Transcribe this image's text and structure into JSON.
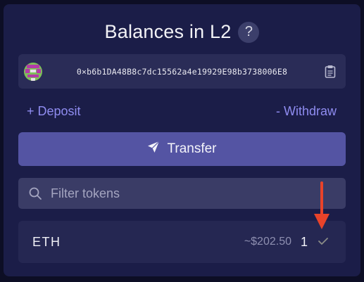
{
  "header": {
    "title": "Balances in L2",
    "help_glyph": "?"
  },
  "account": {
    "address": "0×b6b1DA48B8c7dc15562a4e19929E98b3738006E8",
    "avatar_icon": "identicon",
    "copy_icon": "clipboard-icon"
  },
  "actions": {
    "deposit_label": "+ Deposit",
    "withdraw_label": "- Withdraw",
    "transfer_label": "Transfer"
  },
  "filter": {
    "placeholder": "Filter tokens",
    "value": ""
  },
  "tokens": [
    {
      "symbol": "ETH",
      "usd_value": "~$202.50",
      "amount": "1",
      "status_icon": "check-icon"
    }
  ],
  "colors": {
    "panel": "#1b1d48",
    "accent_button": "#5454a3",
    "link": "#8f8cf0",
    "annotation_arrow": "#e8432a"
  }
}
